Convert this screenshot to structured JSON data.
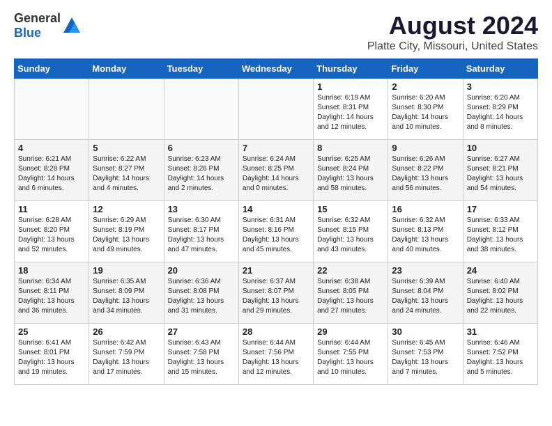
{
  "logo": {
    "text1": "General",
    "text2": "Blue"
  },
  "title": "August 2024",
  "subtitle": "Platte City, Missouri, United States",
  "headers": [
    "Sunday",
    "Monday",
    "Tuesday",
    "Wednesday",
    "Thursday",
    "Friday",
    "Saturday"
  ],
  "weeks": [
    [
      {
        "day": "",
        "info": ""
      },
      {
        "day": "",
        "info": ""
      },
      {
        "day": "",
        "info": ""
      },
      {
        "day": "",
        "info": ""
      },
      {
        "day": "1",
        "info": "Sunrise: 6:19 AM\nSunset: 8:31 PM\nDaylight: 14 hours\nand 12 minutes."
      },
      {
        "day": "2",
        "info": "Sunrise: 6:20 AM\nSunset: 8:30 PM\nDaylight: 14 hours\nand 10 minutes."
      },
      {
        "day": "3",
        "info": "Sunrise: 6:20 AM\nSunset: 8:29 PM\nDaylight: 14 hours\nand 8 minutes."
      }
    ],
    [
      {
        "day": "4",
        "info": "Sunrise: 6:21 AM\nSunset: 8:28 PM\nDaylight: 14 hours\nand 6 minutes."
      },
      {
        "day": "5",
        "info": "Sunrise: 6:22 AM\nSunset: 8:27 PM\nDaylight: 14 hours\nand 4 minutes."
      },
      {
        "day": "6",
        "info": "Sunrise: 6:23 AM\nSunset: 8:26 PM\nDaylight: 14 hours\nand 2 minutes."
      },
      {
        "day": "7",
        "info": "Sunrise: 6:24 AM\nSunset: 8:25 PM\nDaylight: 14 hours\nand 0 minutes."
      },
      {
        "day": "8",
        "info": "Sunrise: 6:25 AM\nSunset: 8:24 PM\nDaylight: 13 hours\nand 58 minutes."
      },
      {
        "day": "9",
        "info": "Sunrise: 6:26 AM\nSunset: 8:22 PM\nDaylight: 13 hours\nand 56 minutes."
      },
      {
        "day": "10",
        "info": "Sunrise: 6:27 AM\nSunset: 8:21 PM\nDaylight: 13 hours\nand 54 minutes."
      }
    ],
    [
      {
        "day": "11",
        "info": "Sunrise: 6:28 AM\nSunset: 8:20 PM\nDaylight: 13 hours\nand 52 minutes."
      },
      {
        "day": "12",
        "info": "Sunrise: 6:29 AM\nSunset: 8:19 PM\nDaylight: 13 hours\nand 49 minutes."
      },
      {
        "day": "13",
        "info": "Sunrise: 6:30 AM\nSunset: 8:17 PM\nDaylight: 13 hours\nand 47 minutes."
      },
      {
        "day": "14",
        "info": "Sunrise: 6:31 AM\nSunset: 8:16 PM\nDaylight: 13 hours\nand 45 minutes."
      },
      {
        "day": "15",
        "info": "Sunrise: 6:32 AM\nSunset: 8:15 PM\nDaylight: 13 hours\nand 43 minutes."
      },
      {
        "day": "16",
        "info": "Sunrise: 6:32 AM\nSunset: 8:13 PM\nDaylight: 13 hours\nand 40 minutes."
      },
      {
        "day": "17",
        "info": "Sunrise: 6:33 AM\nSunset: 8:12 PM\nDaylight: 13 hours\nand 38 minutes."
      }
    ],
    [
      {
        "day": "18",
        "info": "Sunrise: 6:34 AM\nSunset: 8:11 PM\nDaylight: 13 hours\nand 36 minutes."
      },
      {
        "day": "19",
        "info": "Sunrise: 6:35 AM\nSunset: 8:09 PM\nDaylight: 13 hours\nand 34 minutes."
      },
      {
        "day": "20",
        "info": "Sunrise: 6:36 AM\nSunset: 8:08 PM\nDaylight: 13 hours\nand 31 minutes."
      },
      {
        "day": "21",
        "info": "Sunrise: 6:37 AM\nSunset: 8:07 PM\nDaylight: 13 hours\nand 29 minutes."
      },
      {
        "day": "22",
        "info": "Sunrise: 6:38 AM\nSunset: 8:05 PM\nDaylight: 13 hours\nand 27 minutes."
      },
      {
        "day": "23",
        "info": "Sunrise: 6:39 AM\nSunset: 8:04 PM\nDaylight: 13 hours\nand 24 minutes."
      },
      {
        "day": "24",
        "info": "Sunrise: 6:40 AM\nSunset: 8:02 PM\nDaylight: 13 hours\nand 22 minutes."
      }
    ],
    [
      {
        "day": "25",
        "info": "Sunrise: 6:41 AM\nSunset: 8:01 PM\nDaylight: 13 hours\nand 19 minutes."
      },
      {
        "day": "26",
        "info": "Sunrise: 6:42 AM\nSunset: 7:59 PM\nDaylight: 13 hours\nand 17 minutes."
      },
      {
        "day": "27",
        "info": "Sunrise: 6:43 AM\nSunset: 7:58 PM\nDaylight: 13 hours\nand 15 minutes."
      },
      {
        "day": "28",
        "info": "Sunrise: 6:44 AM\nSunset: 7:56 PM\nDaylight: 13 hours\nand 12 minutes."
      },
      {
        "day": "29",
        "info": "Sunrise: 6:44 AM\nSunset: 7:55 PM\nDaylight: 13 hours\nand 10 minutes."
      },
      {
        "day": "30",
        "info": "Sunrise: 6:45 AM\nSunset: 7:53 PM\nDaylight: 13 hours\nand 7 minutes."
      },
      {
        "day": "31",
        "info": "Sunrise: 6:46 AM\nSunset: 7:52 PM\nDaylight: 13 hours\nand 5 minutes."
      }
    ]
  ]
}
